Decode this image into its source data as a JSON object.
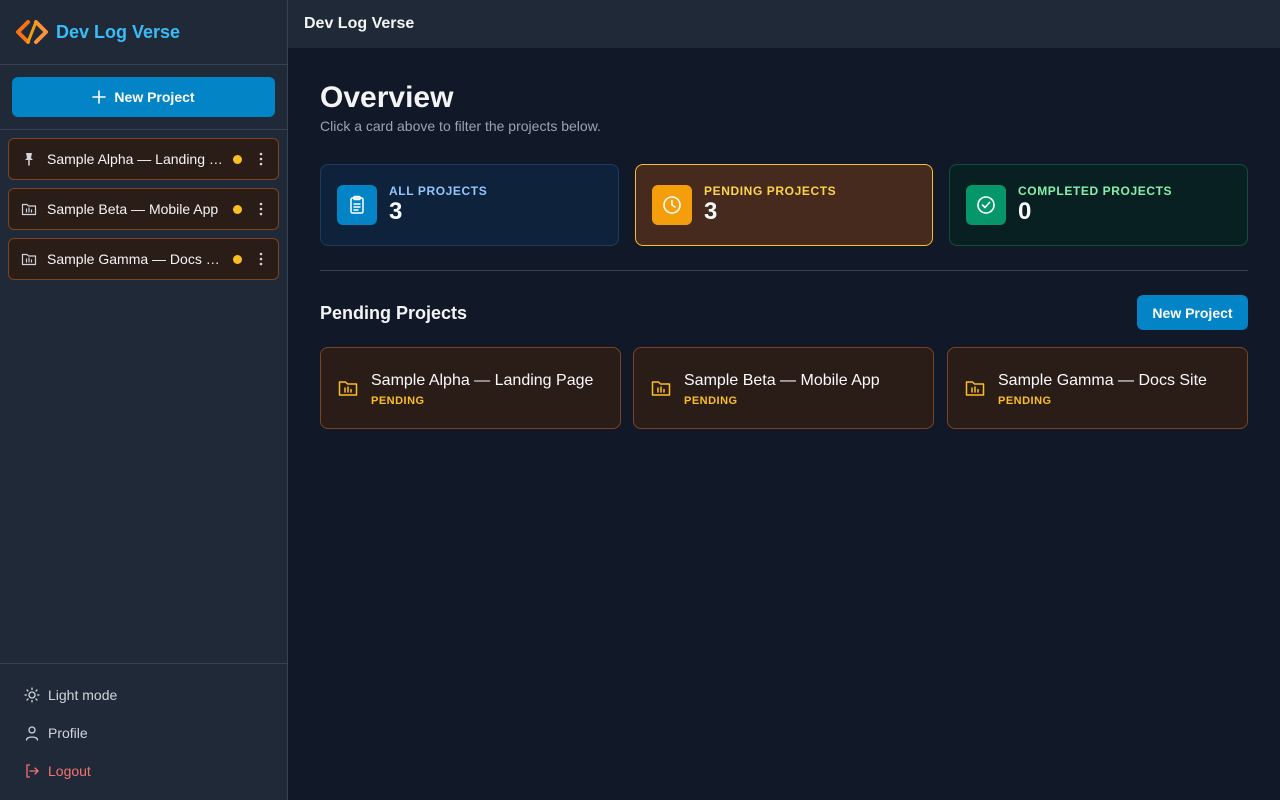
{
  "app": {
    "name": "Dev Log Verse"
  },
  "topbar": {
    "title": "Dev Log Verse"
  },
  "sidebar": {
    "new_project_label": "New Project",
    "projects": [
      {
        "label": "Sample Alpha — Landing Page",
        "icon": "pin-icon"
      },
      {
        "label": "Sample Beta — Mobile App",
        "icon": "folder-icon"
      },
      {
        "label": "Sample Gamma — Docs Site",
        "icon": "folder-icon"
      }
    ],
    "bottom": {
      "theme_label": "Light mode",
      "profile_label": "Profile",
      "logout_label": "Logout"
    }
  },
  "overview": {
    "title": "Overview",
    "subtitle": "Click a card above to filter the projects below.",
    "stats": {
      "all": {
        "label": "ALL PROJECTS",
        "value": "3"
      },
      "pending": {
        "label": "PENDING PROJECTS",
        "value": "3"
      },
      "completed": {
        "label": "COMPLETED PROJECTS",
        "value": "0"
      }
    }
  },
  "section": {
    "title": "Pending Projects",
    "new_project_label": "New Project",
    "cards": [
      {
        "title": "Sample Alpha — Landing Page",
        "status": "PENDING"
      },
      {
        "title": "Sample Beta — Mobile App",
        "status": "PENDING"
      },
      {
        "title": "Sample Gamma — Docs Site",
        "status": "PENDING"
      }
    ]
  },
  "colors": {
    "accent": "#0284c7",
    "brand": "#38bdf8",
    "pending": "#fbbf24",
    "completed": "#059669",
    "danger": "#f87171"
  }
}
